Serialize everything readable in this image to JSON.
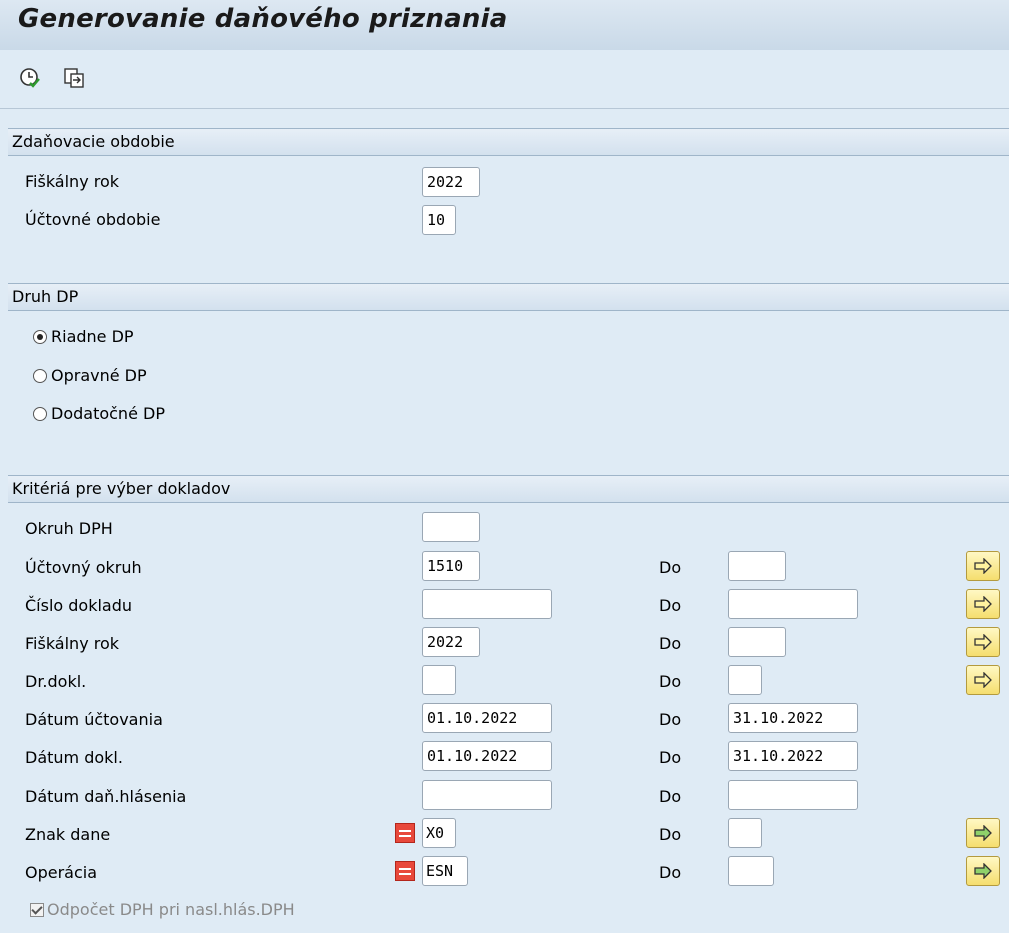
{
  "window": {
    "title": "Generovanie daňového priznania"
  },
  "toolbar": {
    "execute_icon": "execute-clock-icon",
    "variant_icon": "get-variant-icon"
  },
  "period": {
    "header": "Zdaňovacie obdobie",
    "fiscal_year_label": "Fiškálny rok",
    "fiscal_year_value": "2022",
    "posting_period_label": "Účtovné obdobie",
    "posting_period_value": "10"
  },
  "return_type": {
    "header": "Druh DP",
    "options": [
      "Riadne DP",
      "Opravné DP",
      "Dodatočné DP"
    ],
    "selected": "Riadne DP"
  },
  "criteria": {
    "header": "Kritériá pre výber dokladov",
    "to_label": "Do",
    "rows": [
      {
        "label": "Okruh DPH",
        "from": "",
        "to": ""
      },
      {
        "label": "Účtovný okruh",
        "from": "1510",
        "to": ""
      },
      {
        "label": "Číslo dokladu",
        "from": "",
        "to": ""
      },
      {
        "label": "Fiškálny rok",
        "from": "2022",
        "to": ""
      },
      {
        "label": "Dr.dokl.",
        "from": "",
        "to": ""
      },
      {
        "label": "Dátum účtovania",
        "from": "01.10.2022",
        "to": "31.10.2022"
      },
      {
        "label": "Dátum dokl.",
        "from": "01.10.2022",
        "to": "31.10.2022"
      },
      {
        "label": "Dátum daň.hlásenia",
        "from": "",
        "to": ""
      },
      {
        "label": "Znak dane",
        "from": "X0",
        "to": ""
      },
      {
        "label": "Operácia",
        "from": "ESN",
        "to": ""
      }
    ],
    "checkbox_label": "Odpočet DPH pri nasl.hlás.DPH",
    "checkbox_checked": true
  },
  "colors": {
    "background": "#dfebf5",
    "multi_button": "#f5de6e",
    "equals_icon": "#e8483b"
  }
}
